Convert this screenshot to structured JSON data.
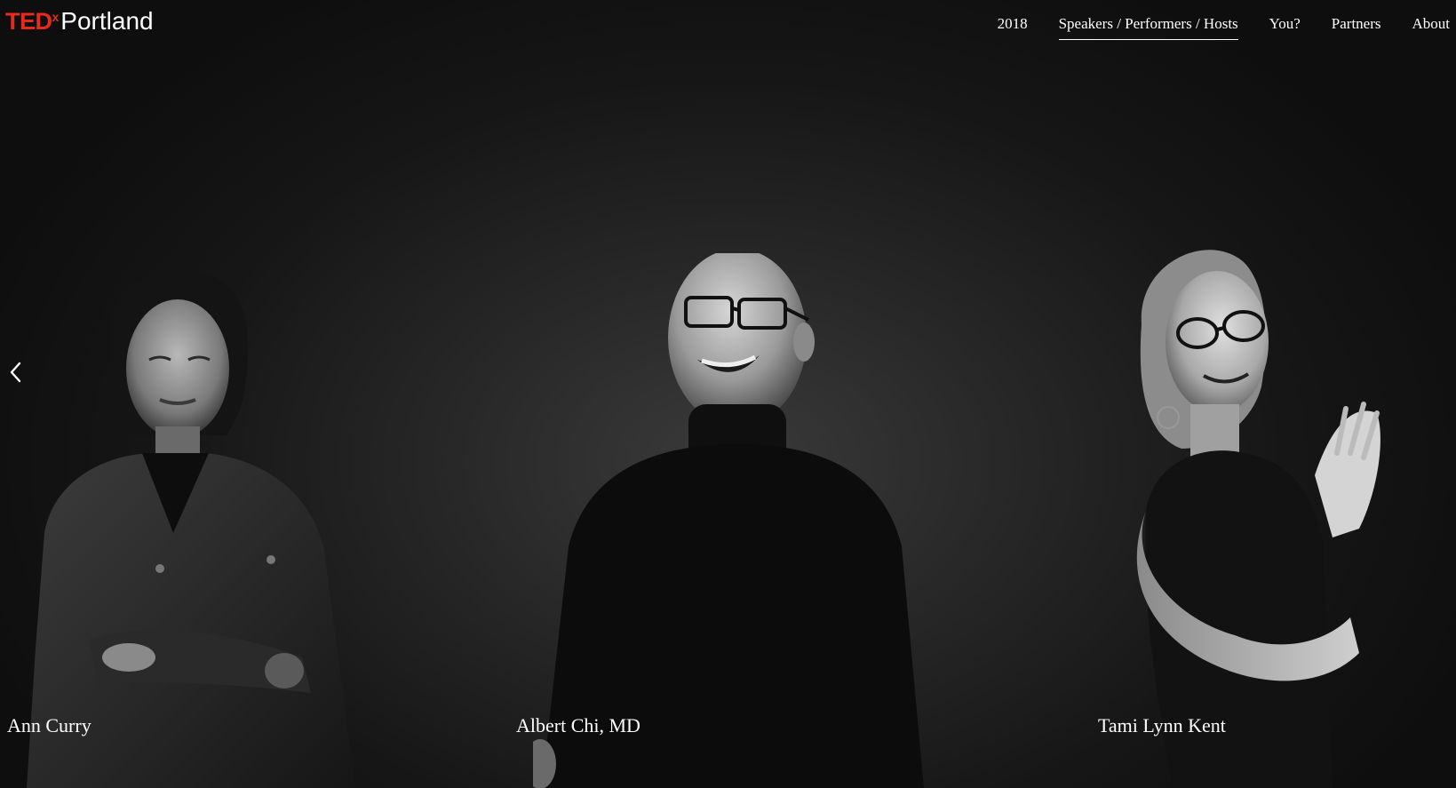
{
  "header": {
    "logo": {
      "ted": "TED",
      "x": "x",
      "city": "Portland"
    },
    "nav": [
      {
        "label": "2018",
        "active": false
      },
      {
        "label": "Speakers / Performers / Hosts",
        "active": true
      },
      {
        "label": "You?",
        "active": false
      },
      {
        "label": "Partners",
        "active": false
      },
      {
        "label": "About",
        "active": false
      }
    ]
  },
  "carousel": {
    "prev_icon": "chevron-left-icon",
    "slides": [
      {
        "name": "Ann Curry"
      },
      {
        "name": "Albert Chi, MD"
      },
      {
        "name": "Tami Lynn Kent"
      }
    ]
  },
  "colors": {
    "brand_red": "#e62b1e",
    "background": "#111111",
    "text": "#ffffff"
  }
}
